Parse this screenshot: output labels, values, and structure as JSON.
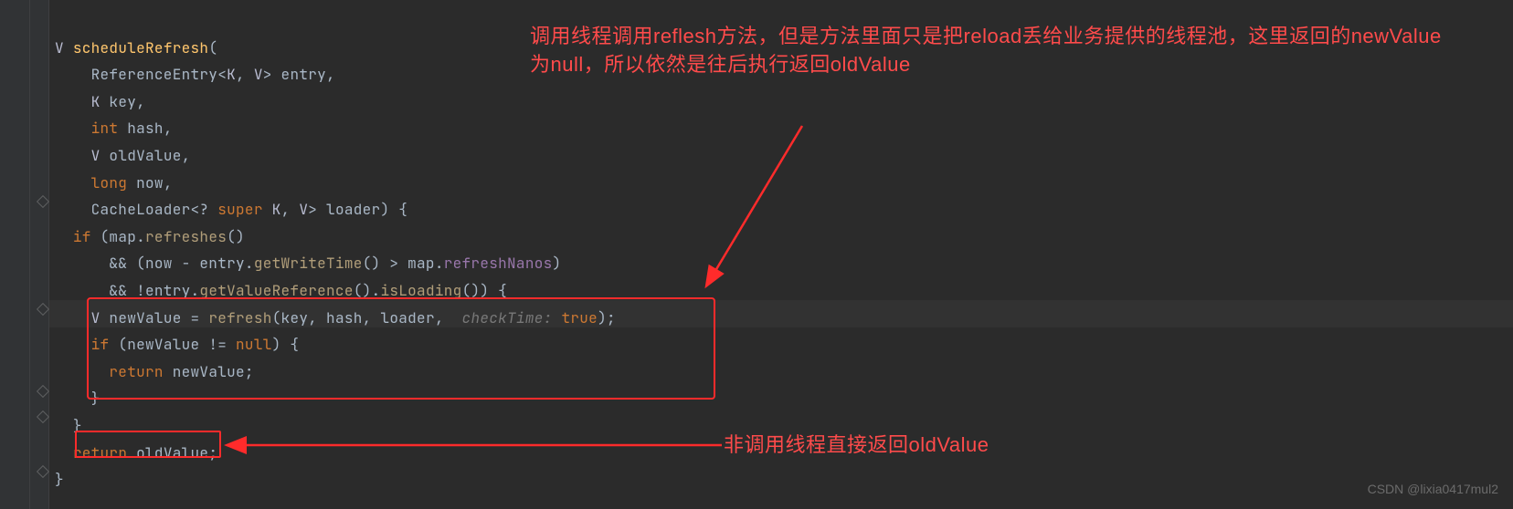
{
  "code": {
    "l1": {
      "type": "V",
      "name": "scheduleRefresh",
      "lp": "("
    },
    "l2": {
      "a": "ReferenceEntry<",
      "b": "K",
      "c": ", ",
      "d": "V",
      "e": "> entry,"
    },
    "l3": {
      "a": "K",
      "b": " key,"
    },
    "l4": {
      "a": "int",
      "b": " hash,"
    },
    "l5": {
      "a": "V",
      "b": " oldValue,"
    },
    "l6": {
      "a": "long",
      "b": " now,"
    },
    "l7": {
      "a": "CacheLoader<? ",
      "b": "super ",
      "c": "K",
      "d": ", ",
      "e": "V",
      "f": "> loader) {"
    },
    "l8": {
      "a": "if ",
      "b": "(map.",
      "c": "refreshes",
      "d": "()"
    },
    "l9": {
      "a": "&& (now - entry.",
      "b": "getWriteTime",
      "c": "() > map.",
      "d": "refreshNanos",
      "e": ")"
    },
    "l10": {
      "a": "&& !entry.",
      "b": "getValueReference",
      "c": "().",
      "d": "isLoading",
      "e": "()) {"
    },
    "l11": {
      "a": "V",
      "b": " newValue = ",
      "c": "refresh",
      "d": "(key, hash, loader, ",
      "hint": " checkTime: ",
      "e": "true",
      "f": ");"
    },
    "l12": {
      "a": "if ",
      "b": "(newValue != ",
      "c": "null",
      "d": ") {"
    },
    "l13": {
      "a": "return ",
      "b": "newValue;"
    },
    "l14": {
      "a": "}"
    },
    "l15": {
      "a": "}"
    },
    "l16": {
      "a": "return ",
      "b": "oldValue;"
    },
    "l17": {
      "a": "}"
    }
  },
  "annotations": {
    "top": "调用线程调用reflesh方法，但是方法里面只是把reload丢给业务提供的线程池，这里返回的newValue为null，所以依然是往后执行返回oldValue",
    "bottom": "非调用线程直接返回oldValue"
  },
  "watermark": "CSDN @lixia0417mul2",
  "colors": {
    "keyword": "#cc7832",
    "annotation": "#ff4b4b",
    "box": "#ff2b2b",
    "bg": "#2b2b2b"
  }
}
